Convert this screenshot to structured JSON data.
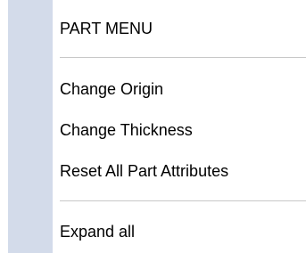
{
  "menu": {
    "header": "PART MENU",
    "items": [
      {
        "label": "Change Origin"
      },
      {
        "label": "Change Thickness"
      },
      {
        "label": "Reset All Part Attributes"
      },
      {
        "label": "Expand all"
      }
    ]
  },
  "colors": {
    "gutter": "#d3dbea",
    "separator": "#c8c8c8",
    "background": "#ffffff",
    "text": "#000000"
  }
}
